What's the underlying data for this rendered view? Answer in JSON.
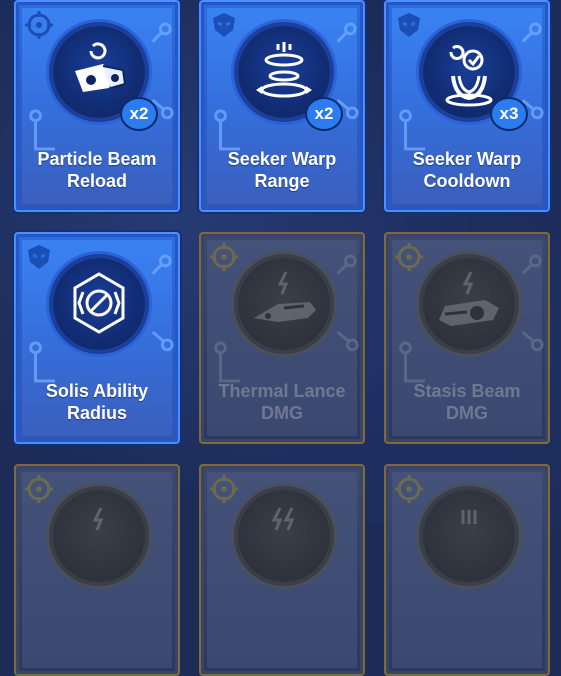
{
  "cards": [
    {
      "line1": "Particle Beam",
      "line2": "Reload",
      "badge": "x2",
      "state": "active",
      "emblem": "faction-icon",
      "icon": "particle-beam-icon"
    },
    {
      "line1": "Seeker Warp",
      "line2": "Range",
      "badge": "x2",
      "state": "active",
      "emblem": "faction-icon",
      "icon": "warp-range-icon"
    },
    {
      "line1": "Seeker Warp",
      "line2": "Cooldown",
      "badge": "x3",
      "state": "active",
      "emblem": "faction-icon",
      "icon": "warp-cooldown-icon"
    },
    {
      "line1": "Solis Ability",
      "line2": "Radius",
      "badge": "",
      "state": "active",
      "emblem": "faction-icon",
      "icon": "solis-radius-icon"
    },
    {
      "line1": "Thermal Lance",
      "line2": "DMG",
      "badge": "",
      "state": "locked",
      "emblem": "crosshair-icon",
      "icon": "thermal-lance-icon"
    },
    {
      "line1": "Stasis Beam",
      "line2": "DMG",
      "badge": "",
      "state": "locked",
      "emblem": "crosshair-icon",
      "icon": "stasis-beam-icon"
    },
    {
      "line1": "",
      "line2": "",
      "badge": "",
      "state": "locked",
      "emblem": "crosshair-icon",
      "icon": "lightning-icon"
    },
    {
      "line1": "",
      "line2": "",
      "badge": "",
      "state": "locked",
      "emblem": "crosshair-icon",
      "icon": "lightning-icon"
    },
    {
      "line1": "",
      "line2": "",
      "badge": "",
      "state": "locked",
      "emblem": "crosshair-icon",
      "icon": "missile-icon"
    }
  ]
}
